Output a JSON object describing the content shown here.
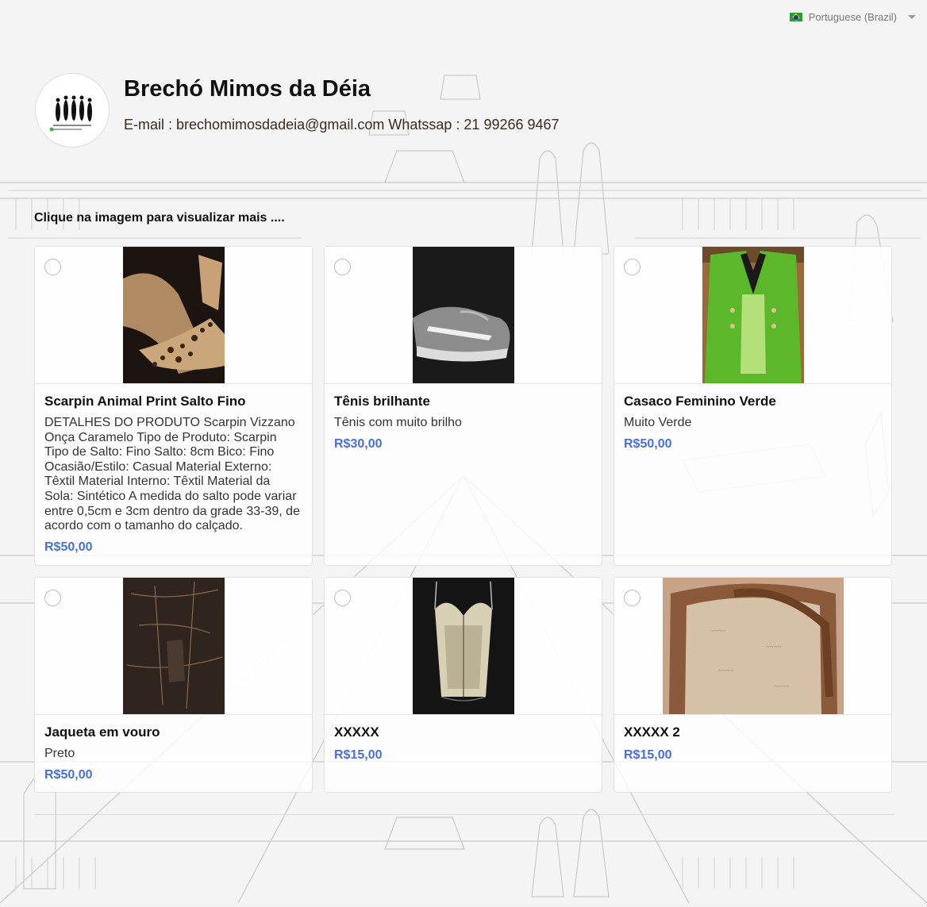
{
  "language": {
    "label": "Portuguese (Brazil)",
    "flag_icon": "brazil-flag-icon"
  },
  "store": {
    "name": "Brechó Mimos da Déia",
    "contact": "E-mail : brechomimosdadeia@gmail.com Whatssap : 21 99266 9467",
    "logo_text": "Brechó - Mimos da Déia"
  },
  "hint": "Clique na imagem para visualizar mais ....",
  "colors": {
    "price": "#4a6fdb",
    "border": "#e1e1e1"
  },
  "products": [
    {
      "name": "Scarpin Animal Print Salto Fino",
      "description": "DETALHES DO PRODUTO Scarpin Vizzano Onça Caramelo Tipo de Produto: Scarpin Tipo de Salto: Fino Salto: 8cm Bico: Fino Ocasião/Estilo: Casual Material Externo: Têxtil Material Interno: Têxtil Material da Sola: Sintético A medida do salto pode variar entre 0,5cm e 3cm dentro da grade 33-39, de acordo com o tamanho do calçado.",
      "price": "R$50,00"
    },
    {
      "name": "Tênis brilhante",
      "description": "Tênis com muito brilho",
      "price": "R$30,00"
    },
    {
      "name": "Casaco Feminino Verde",
      "description": "Muito Verde",
      "price": "R$50,00"
    },
    {
      "name": "Jaqueta em vouro",
      "description": "Preto",
      "price": "R$50,00"
    },
    {
      "name": "XXXXX",
      "description": "",
      "price": "R$15,00"
    },
    {
      "name": "XXXXX 2",
      "description": "",
      "price": "R$15,00"
    }
  ]
}
